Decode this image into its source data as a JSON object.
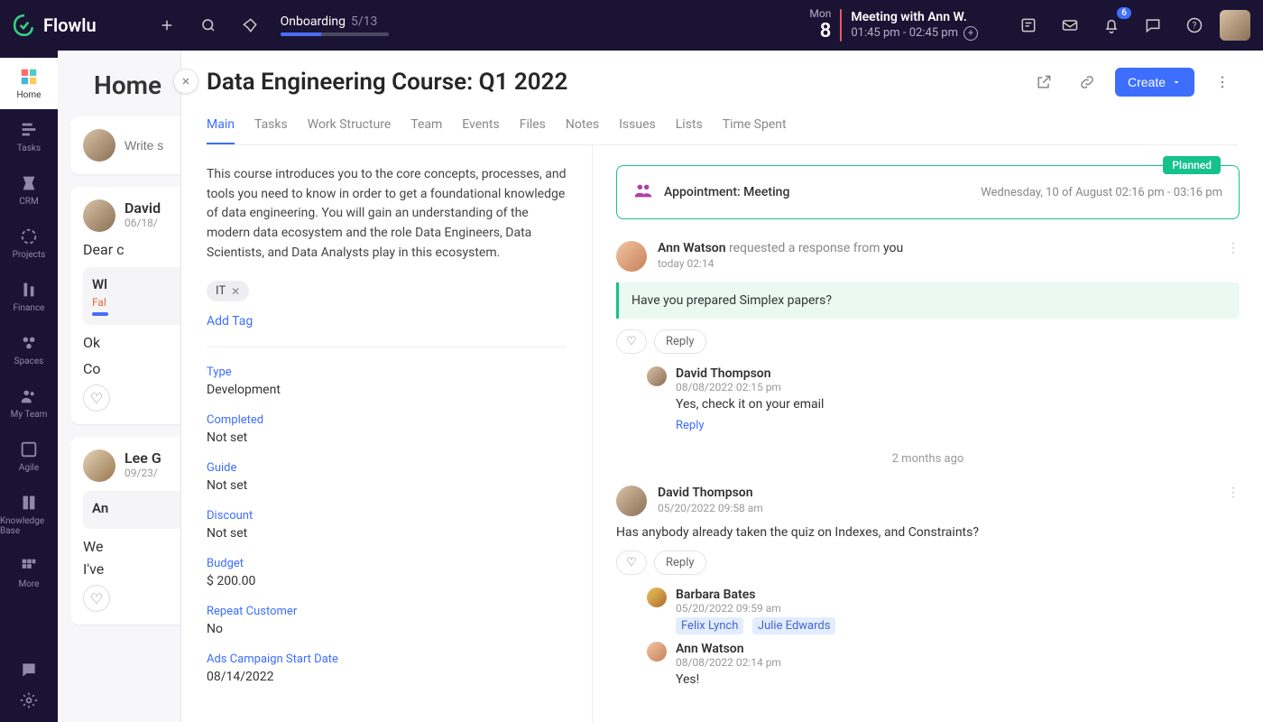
{
  "brand": "Flowlu",
  "accent": "#3d6eff",
  "onboarding": {
    "label": "Onboarding",
    "count": "5/13",
    "progress_pct": 38
  },
  "date": {
    "dow": "Mon",
    "day": "8"
  },
  "meeting": {
    "title": "Meeting with Ann W.",
    "time": "01:45 pm - 02:45 pm"
  },
  "notif_count": "6",
  "rail": [
    {
      "icon": "home",
      "label": "Home",
      "active": true
    },
    {
      "icon": "tasks",
      "label": "Tasks"
    },
    {
      "icon": "crm",
      "label": "CRM"
    },
    {
      "icon": "projects",
      "label": "Projects"
    },
    {
      "icon": "finance",
      "label": "Finance"
    },
    {
      "icon": "spaces",
      "label": "Spaces"
    },
    {
      "icon": "team",
      "label": "My Team"
    },
    {
      "icon": "agile",
      "label": "Agile"
    },
    {
      "icon": "kb",
      "label": "Knowledge Base"
    },
    {
      "icon": "more",
      "label": "More"
    }
  ],
  "home_title": "Home",
  "composer_placeholder": "Write s",
  "feed": [
    {
      "author": "David",
      "date": "06/18/",
      "greeting": "Dear c",
      "card": {
        "title": "Wl",
        "status": "Fal"
      },
      "replies": [
        "Ok",
        "Co"
      ]
    },
    {
      "author": "Lee G",
      "date": "09/23/",
      "card": {
        "title": "An"
      },
      "lines": [
        "We",
        "I've"
      ]
    }
  ],
  "record": {
    "title": "Data Engineering Course: Q1 2022",
    "create_label": "Create",
    "tabs": [
      "Main",
      "Tasks",
      "Work Structure",
      "Team",
      "Events",
      "Files",
      "Notes",
      "Issues",
      "Lists",
      "Time Spent"
    ],
    "active_tab": "Main",
    "description": "This course introduces you to the core concepts, processes, and tools you need to know in order to get a foundational knowledge of data engineering. You will gain an understanding of the modern data ecosystem and the role Data Engineers, Data Scientists, and Data Analysts play in this ecosystem.",
    "tag": "IT",
    "add_tag": "Add Tag",
    "fields": [
      {
        "label": "Type",
        "value": "Development"
      },
      {
        "label": "Completed",
        "value": "Not set"
      },
      {
        "label": "Guide",
        "value": "Not set"
      },
      {
        "label": "Discount",
        "value": "Not set"
      },
      {
        "label": "Budget",
        "value": "$ 200.00"
      },
      {
        "label": "Repeat Customer",
        "value": "No"
      },
      {
        "label": "Ads Campaign Start Date",
        "value": "08/14/2022"
      }
    ]
  },
  "appointment": {
    "badge": "Planned",
    "title": "Appointment: Meeting",
    "when": "Wednesday, 10 of August 02:16 pm - 03:16 pm"
  },
  "activity1": {
    "author": "Ann Watson",
    "action": "requested a response from",
    "target": "you",
    "ts": "today 02:14",
    "quote": "Have you prepared Simplex papers?",
    "reply_label": "Reply",
    "thread": [
      {
        "author": "David Thompson",
        "ts": "08/08/2022 02:15 pm",
        "body": "Yes, check it on your email",
        "reply": "Reply"
      }
    ]
  },
  "divider": "2 months ago",
  "activity2": {
    "author": "David Thompson",
    "ts": "05/20/2022 09:58 am",
    "body": "Has anybody already taken the quiz on Indexes, and Constraints?",
    "reply_label": "Reply",
    "thread": [
      {
        "author": "Barbara Bates",
        "ts": "05/20/2022 09:59 am",
        "mentions": [
          "Felix Lynch",
          "Julie Edwards"
        ]
      },
      {
        "author": "Ann Watson",
        "ts": "08/08/2022 02:14 pm",
        "body": "Yes!"
      }
    ]
  }
}
